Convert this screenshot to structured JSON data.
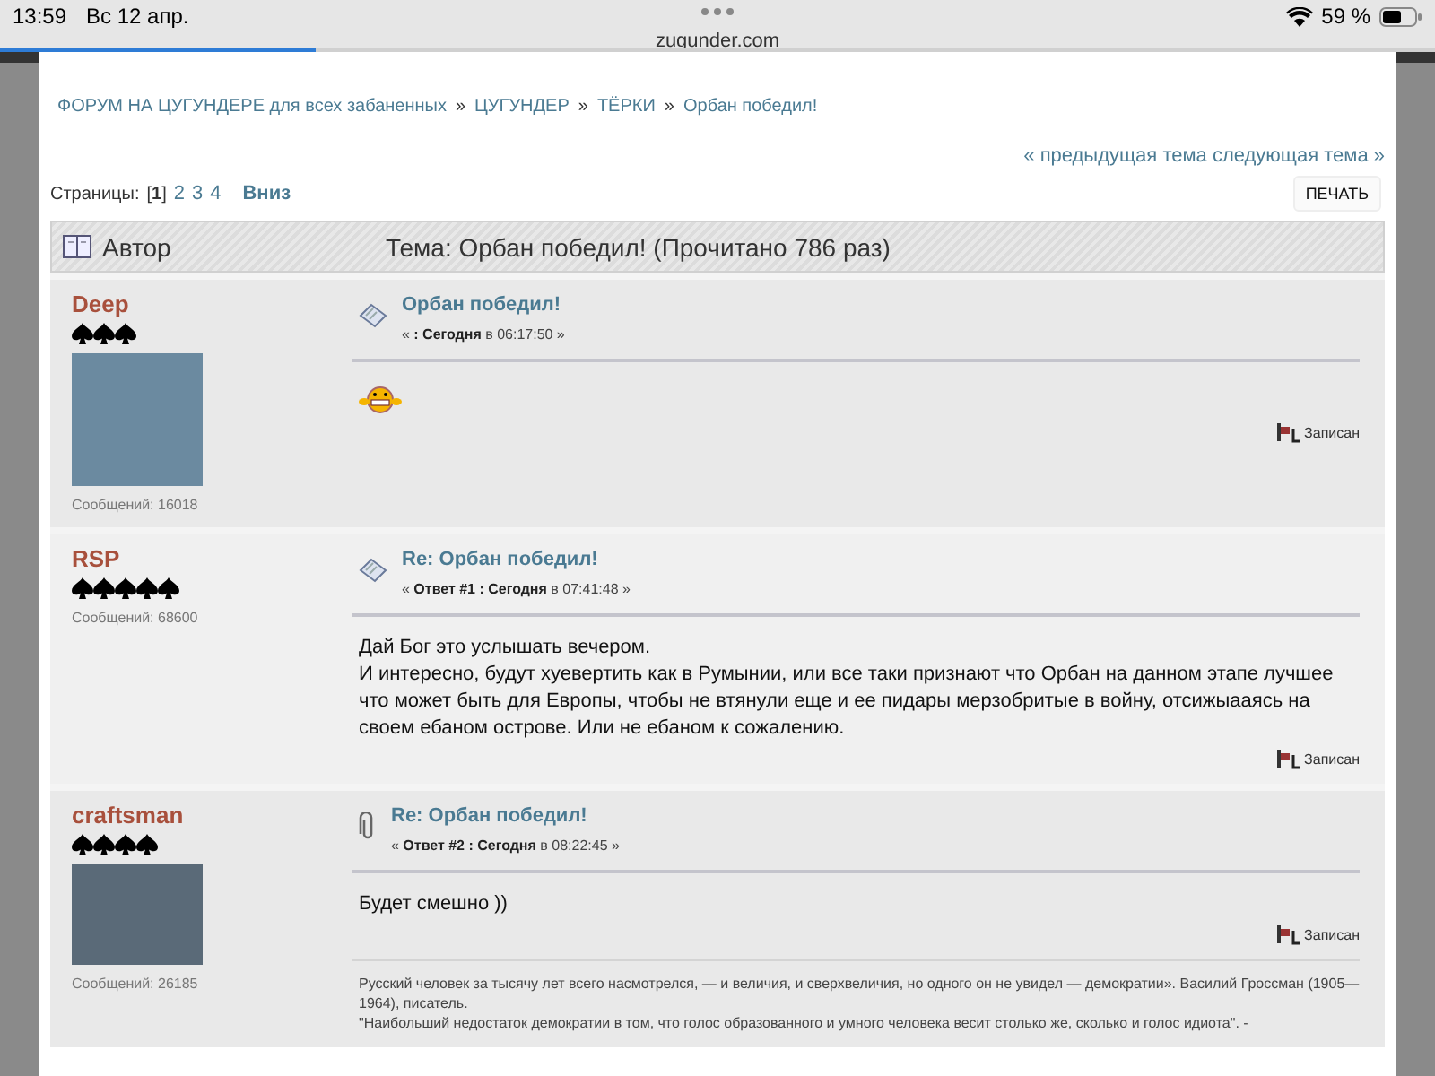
{
  "status_bar": {
    "time": "13:59",
    "date": "Вс 12 апр.",
    "battery": "59 %"
  },
  "browser": {
    "url": "zugunder.com"
  },
  "breadcrumb": [
    {
      "label": "ФОРУМ НА ЦУГУНДЕРЕ для всех забаненных",
      "sep": "»"
    },
    {
      "label": "ЦУГУНДЕР",
      "sep": "»"
    },
    {
      "label": "ТЁРКИ",
      "sep": "»"
    },
    {
      "label": "Орбан победил!"
    }
  ],
  "topic_nav": "« предыдущая тема следующая тема »",
  "pages": {
    "label": "Страницы:",
    "items": [
      {
        "label": "[**1**]",
        "selected": true
      },
      {
        "label": "2",
        "selected": false
      },
      {
        "label": "3",
        "selected": false
      },
      {
        "label": "4",
        "selected": false
      }
    ],
    "down": "Вниз"
  },
  "print_button": "ПЕЧАТЬ",
  "header": {
    "author": "Автор",
    "topic": "Тема: Орбан победил!  (Прочитано 786 раз)"
  },
  "posts": [
    {
      "author": "Deep",
      "stars": 3,
      "avatar": true,
      "count": "Сообщений: 16018",
      "kind": "doc",
      "title": "Орбан победил!",
      "meta": "« **: Сегодня** в 06:17:50 »",
      "body": [
        {
          "kind": "smiley"
        }
      ],
      "saved": "Записан"
    },
    {
      "author": "RSP",
      "stars": 5,
      "avatar": false,
      "count": "Сообщений: 68600",
      "kind": "doc",
      "title": "Re: Орбан победил!",
      "meta": "« **Ответ #1 : Сегодня** в 07:41:48 »",
      "body": [
        {
          "kind": "text",
          "text": "Дай Бог это услышать вечером."
        },
        {
          "kind": "text",
          "text": "И интересно, будут хуевертить как в Румынии, или все таки признают что Орбан на данном этапе лучшее что может быть для Европы, чтобы не втянули еще и ее пидары мерзобритые в войну, отсижыааясь на своем ебаном острове. Или не ебаном к сожалению."
        }
      ],
      "saved": "Записан"
    },
    {
      "author": "craftsman",
      "stars": 4,
      "avatar": true,
      "count": "Сообщений: 26185",
      "kind": "clip",
      "title": "Re: Орбан победил!",
      "meta": "« **Ответ #2 : Сегодня** в 08:22:45 »",
      "body": [
        {
          "kind": "text",
          "text": "Будет смешно ))"
        }
      ],
      "saved": "Записан",
      "signature": [
        "Русский человек за тысячу лет всего насмотрелся, — и величия, и сверхвеличия, но одного он не увидел — демократии». Василий Гроссман (1905—1964), писатель.",
        "\"Наибольший недостаток демократии в том, что голос образованного и умного человека весит столько же, сколько и голос идиота\". -"
      ]
    }
  ]
}
